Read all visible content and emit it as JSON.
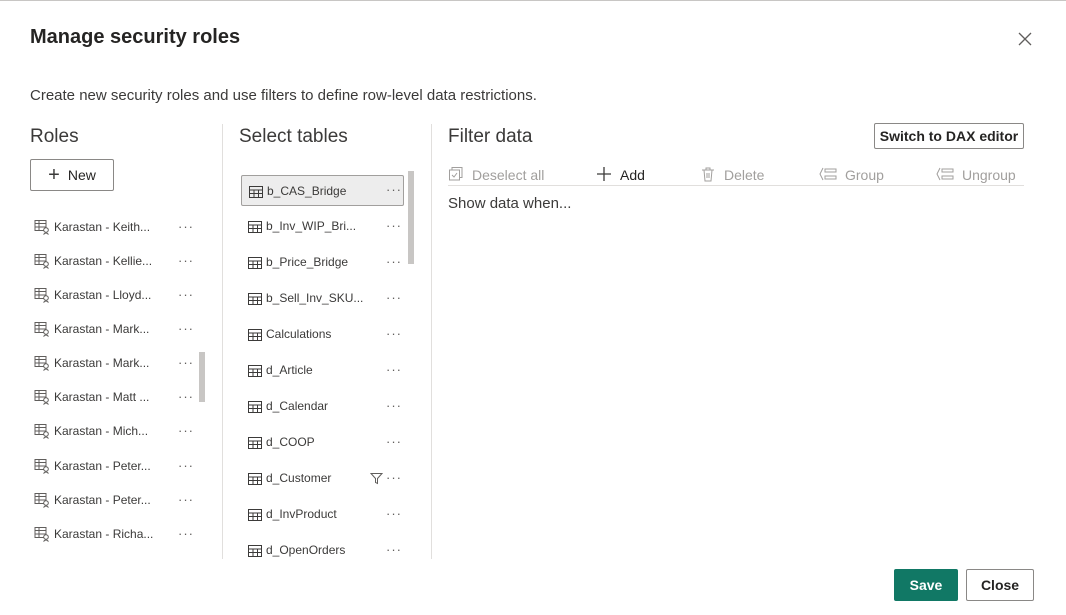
{
  "dialog": {
    "title": "Manage security roles",
    "description": "Create new security roles and use filters to define row-level data restrictions.",
    "close_icon": "close-icon"
  },
  "roles": {
    "heading": "Roles",
    "new_label": "New",
    "items": [
      {
        "label": "Karastan - Keith..."
      },
      {
        "label": "Karastan - Kellie..."
      },
      {
        "label": "Karastan - Lloyd..."
      },
      {
        "label": "Karastan - Mark..."
      },
      {
        "label": "Karastan - Mark..."
      },
      {
        "label": "Karastan - Matt ..."
      },
      {
        "label": "Karastan - Mich..."
      },
      {
        "label": "Karastan - Peter..."
      },
      {
        "label": "Karastan - Peter..."
      },
      {
        "label": "Karastan - Richa..."
      }
    ],
    "more": "···"
  },
  "tables": {
    "heading": "Select tables",
    "items": [
      {
        "label": "b_CAS_Bridge",
        "selected": true
      },
      {
        "label": "b_Inv_WIP_Bri..."
      },
      {
        "label": "b_Price_Bridge"
      },
      {
        "label": "b_Sell_Inv_SKU..."
      },
      {
        "label": "Calculations"
      },
      {
        "label": "d_Article"
      },
      {
        "label": "d_Calendar"
      },
      {
        "label": "d_COOP"
      },
      {
        "label": "d_Customer",
        "filtered": true
      },
      {
        "label": "d_InvProduct"
      },
      {
        "label": "d_OpenOrders"
      }
    ],
    "more": "···"
  },
  "filter": {
    "heading": "Filter data",
    "dax_button": "Switch to DAX editor",
    "toolbar": {
      "deselect_all": "Deselect all",
      "add": "Add",
      "delete": "Delete",
      "group": "Group",
      "ungroup": "Ungroup"
    },
    "show_when": "Show data when..."
  },
  "footer": {
    "save": "Save",
    "close": "Close"
  },
  "colors": {
    "accent": "#117865",
    "border": "#8a8886",
    "selected_bg": "#ededed"
  }
}
